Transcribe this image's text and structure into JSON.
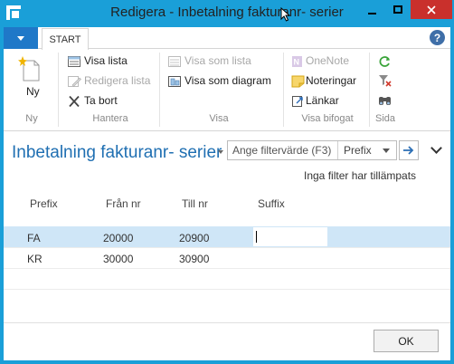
{
  "window": {
    "title": "Redigera - Inbetalning fakturanr- serier",
    "title_bar_color": "#1a9fd8",
    "close_button_color": "#c9302c",
    "controls": [
      "minimize-icon",
      "maximize-icon",
      "close-icon"
    ]
  },
  "ribbon": {
    "tabs": [
      {
        "label": "START",
        "selected": true
      }
    ],
    "file_menu_icon": "triangle-down-icon",
    "help_icon": "help-icon",
    "groups": {
      "ny": {
        "label": "Ny",
        "new_label": "Ny"
      },
      "hantera": {
        "label": "Hantera",
        "visa_lista": "Visa lista",
        "redigera_lista": "Redigera lista",
        "ta_bort": "Ta bort"
      },
      "visa": {
        "label": "Visa",
        "visa_som_lista": "Visa som lista",
        "visa_som_diagram": "Visa som diagram"
      },
      "visa_bifogat": {
        "label": "Visa bifogat",
        "onenote": "OneNote",
        "noteringar": "Noteringar",
        "lankar": "Länkar"
      },
      "sida": {
        "label": "Sida"
      }
    }
  },
  "page": {
    "title": "Inbetalning fakturanr- serier",
    "accent_color": "#1f6fb2",
    "filter": {
      "placeholder": "Ange filtervärde (F3)",
      "field": "Prefix",
      "status": "Inga filter har tillämpats"
    }
  },
  "table": {
    "columns": [
      "Prefix",
      "Från nr",
      "Till nr",
      "Suffix"
    ],
    "rows": [
      {
        "prefix": "FA",
        "from": "20000",
        "to": "20900",
        "suffix": ""
      },
      {
        "prefix": "KR",
        "from": "30000",
        "to": "30900",
        "suffix": ""
      }
    ],
    "selected_row_color": "#cfe6f7"
  },
  "footer": {
    "ok_label": "OK"
  }
}
